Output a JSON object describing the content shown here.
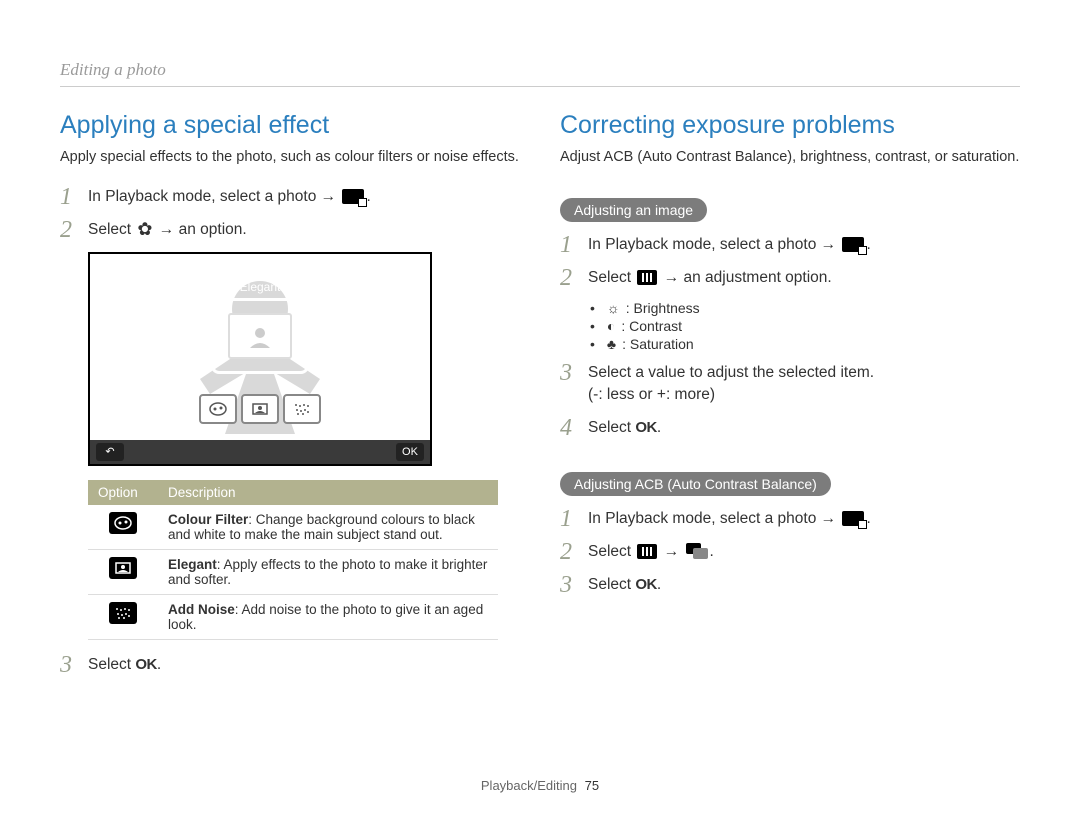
{
  "breadcrumb": "Editing a photo",
  "left": {
    "heading": "Applying a special effect",
    "intro": "Apply special effects to the photo, such as colour filters or noise effects.",
    "step1": "In Playback mode, select a photo → ",
    "step2_a": "Select ",
    "step2_b": " → an option.",
    "screen_label": "Elegant",
    "table": {
      "h1": "Option",
      "h2": "Description",
      "r1_name": "Colour Filter",
      "r1_desc": ": Change background colours to black and white to make the main subject stand out.",
      "r2_name": "Elegant",
      "r2_desc": ": Apply effects to the photo to make it brighter and softer.",
      "r3_name": "Add Noise",
      "r3_desc": ": Add noise to the photo to give it an aged look."
    },
    "step3": "Select "
  },
  "right": {
    "heading": "Correcting exposure problems",
    "intro": "Adjust ACB (Auto Contrast Balance), brightness, contrast, or saturation.",
    "pill1": "Adjusting an image",
    "s1": "In Playback mode, select a photo → ",
    "s2_a": "Select ",
    "s2_b": " → an adjustment option.",
    "opt_brightness": ": Brightness",
    "opt_contrast": ": Contrast",
    "opt_saturation": ": Saturation",
    "s3_a": "Select a value to adjust the selected item.",
    "s3_b": "(-: less or +: more)",
    "s4": "Select ",
    "pill2": "Adjusting ACB (Auto Contrast Balance)",
    "a1": "In Playback mode, select a photo → ",
    "a2_a": "Select ",
    "a2_b": " → ",
    "a3": "Select "
  },
  "ok_label": "OK",
  "footer_section": "Playback/Editing",
  "footer_page": "75"
}
